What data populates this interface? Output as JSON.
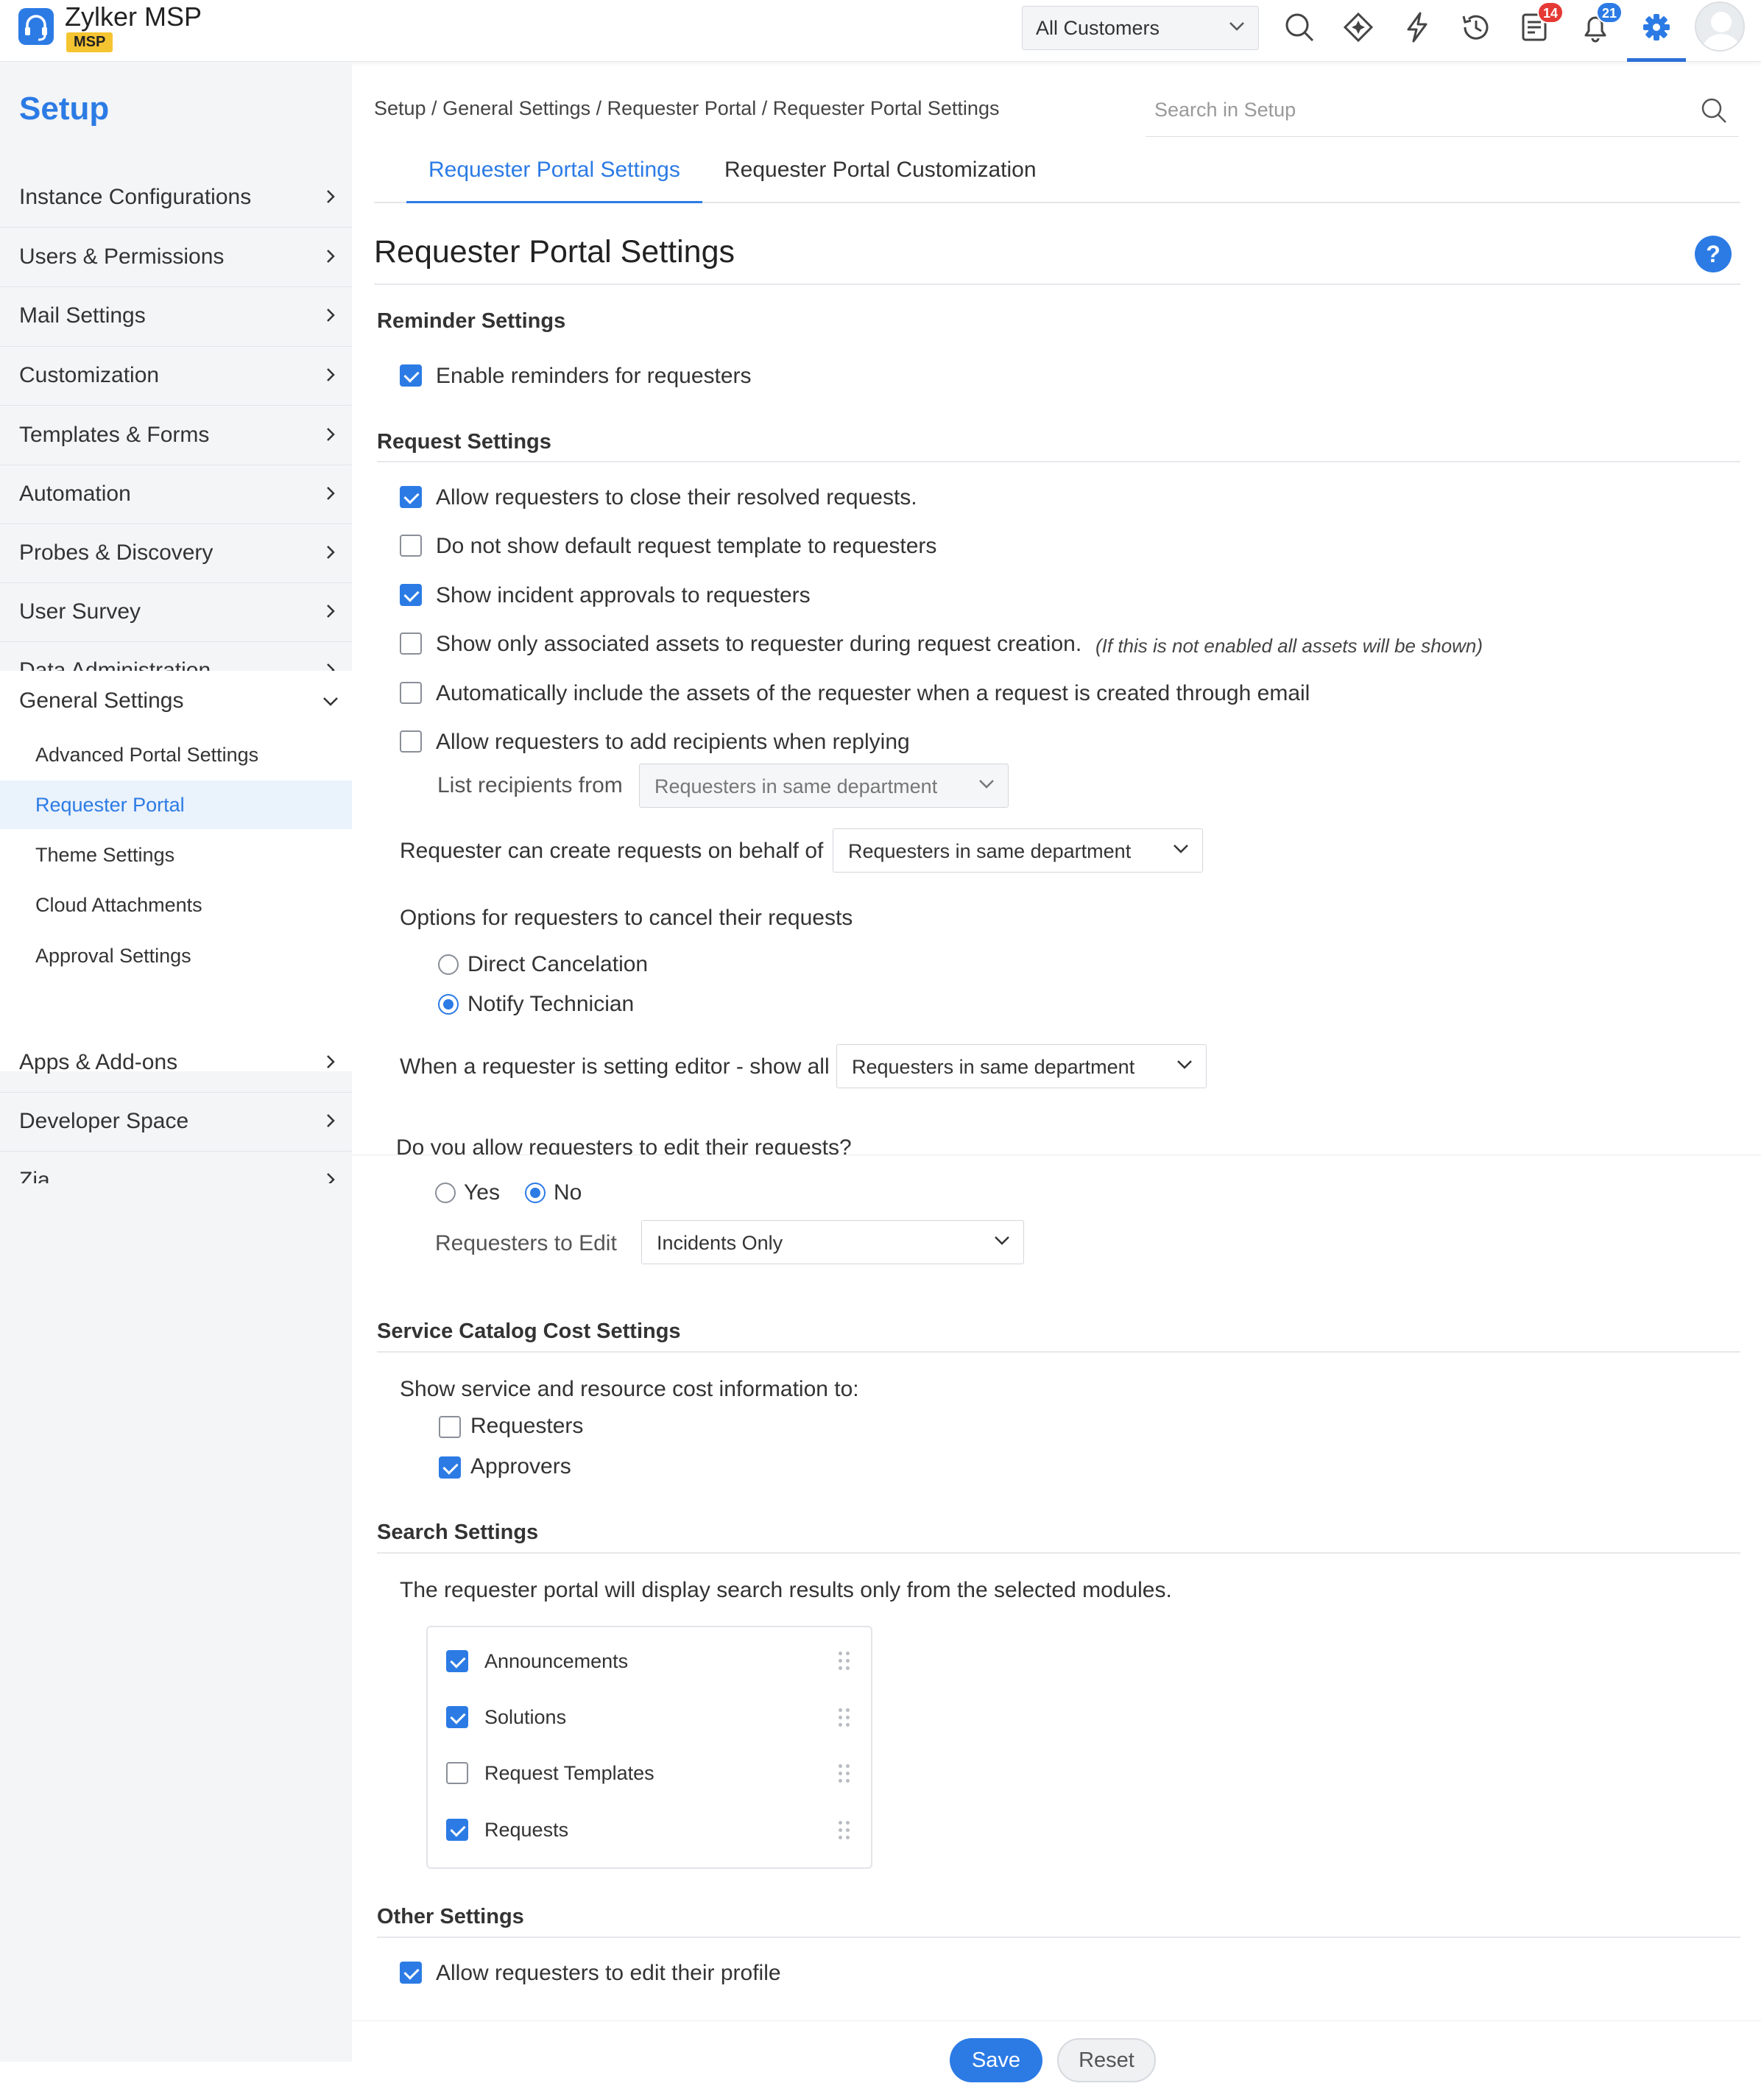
{
  "app": {
    "name": "Zylker MSP",
    "badge": "MSP"
  },
  "header": {
    "customer_select": "All Customers",
    "badges": {
      "tasks": "14",
      "notifications": "21"
    },
    "icons": [
      "search-icon",
      "zia-icon",
      "quick-actions-icon",
      "history-icon",
      "tasks-icon",
      "notifications-icon",
      "gear-icon",
      "avatar"
    ],
    "accent_color": "#2c7be5",
    "badge_colors": {
      "tasks": "#e53935",
      "notifications": "#2c7be5"
    }
  },
  "sidebar": {
    "title": "Setup",
    "items": [
      {
        "label": "Instance Configurations"
      },
      {
        "label": "Users & Permissions"
      },
      {
        "label": "Mail Settings"
      },
      {
        "label": "Customization"
      },
      {
        "label": "Templates & Forms"
      },
      {
        "label": "Automation"
      },
      {
        "label": "Probes & Discovery"
      },
      {
        "label": "User Survey"
      },
      {
        "label": "Data Administration"
      },
      {
        "label": "General Settings"
      },
      {
        "label": "Apps & Add-ons"
      },
      {
        "label": "Developer Space"
      },
      {
        "label": "Zia"
      }
    ],
    "sub_items": [
      {
        "label": "Advanced Portal Settings"
      },
      {
        "label": "Requester Portal"
      },
      {
        "label": "Theme Settings"
      },
      {
        "label": "Cloud Attachments"
      },
      {
        "label": "Approval Settings"
      }
    ]
  },
  "breadcrumb": "Setup / General Settings / Requester Portal / Requester Portal Settings",
  "search": {
    "placeholder": "Search in Setup"
  },
  "tabs": [
    {
      "label": "Requester Portal Settings"
    },
    {
      "label": "Requester Portal Customization"
    }
  ],
  "page_title": "Requester Portal Settings",
  "help_label": "?",
  "reminder": {
    "heading": "Reminder Settings",
    "enable_reminders": {
      "label": "Enable reminders for requesters",
      "checked": true
    }
  },
  "request": {
    "heading": "Request Settings",
    "options": [
      {
        "label": "Allow requesters to close their resolved requests.",
        "checked": true
      },
      {
        "label": "Do not show default request template to requesters",
        "checked": false
      },
      {
        "label": "Show incident approvals to requesters",
        "checked": true
      },
      {
        "label": "Show only associated assets to requester during request creation.",
        "checked": false
      },
      {
        "label": "Automatically include the assets of the requester when a request is created through email",
        "checked": false
      },
      {
        "label": "Allow requesters to add recipients when replying",
        "checked": false
      }
    ],
    "assets_note": "(If this is not enabled all assets will be shown)",
    "list_recipients": {
      "label": "List recipients from",
      "value": "Requesters in same department"
    },
    "behalf": {
      "label": "Requester can create requests on behalf of",
      "value": "Requesters in same department"
    },
    "cancel": {
      "label": "Options for requesters to cancel their requests",
      "options": [
        {
          "label": "Direct Cancelation",
          "selected": false
        },
        {
          "label": "Notify Technician",
          "selected": true
        }
      ]
    },
    "editor": {
      "label": "When a requester is setting editor - show all",
      "value": "Requesters in same department"
    },
    "edit_requests": {
      "label": "Do you allow requesters to edit their requests?",
      "options": [
        {
          "label": "Yes",
          "selected": false
        },
        {
          "label": "No",
          "selected": true
        }
      ],
      "to_edit_label": "Requesters to Edit",
      "to_edit_value": "Incidents Only"
    }
  },
  "service_catalog": {
    "heading": "Service Catalog Cost Settings",
    "label": "Show service and resource cost information to:",
    "options": [
      {
        "label": "Requesters",
        "checked": false
      },
      {
        "label": "Approvers",
        "checked": true
      }
    ]
  },
  "search_settings": {
    "heading": "Search Settings",
    "description": "The requester portal will display search results only from the selected modules.",
    "modules": [
      {
        "label": "Announcements",
        "checked": true
      },
      {
        "label": "Solutions",
        "checked": true
      },
      {
        "label": "Request Templates",
        "checked": false
      },
      {
        "label": "Requests",
        "checked": true
      }
    ]
  },
  "other": {
    "heading": "Other Settings",
    "edit_profile": {
      "label": "Allow requesters to edit their profile",
      "checked": true
    }
  },
  "buttons": {
    "save": "Save",
    "reset": "Reset"
  }
}
